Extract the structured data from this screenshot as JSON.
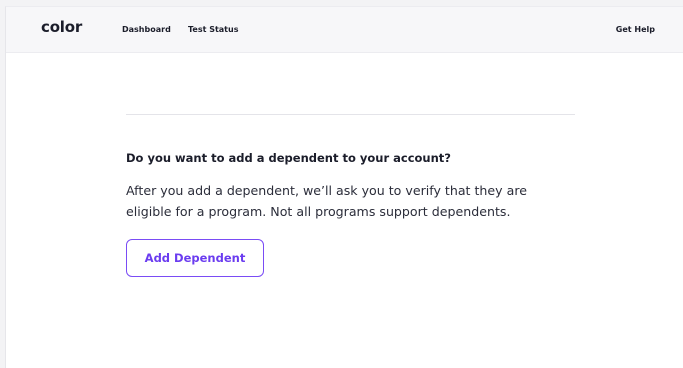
{
  "header": {
    "logo_text": "color",
    "nav": {
      "dashboard": "Dashboard",
      "test_status": "Test Status",
      "get_help": "Get Help"
    }
  },
  "main": {
    "question": "Do you want to add a dependent to your account?",
    "description_line1": "After you add a dependent, we’ll ask you to verify that they are",
    "description_line2": "eligible for a program. Not all programs support dependents.",
    "add_button_label": "Add Dependent"
  },
  "colors": {
    "accent": "#7a4cf5",
    "text": "#1b1d2a",
    "header_bg": "#f7f7f9"
  }
}
